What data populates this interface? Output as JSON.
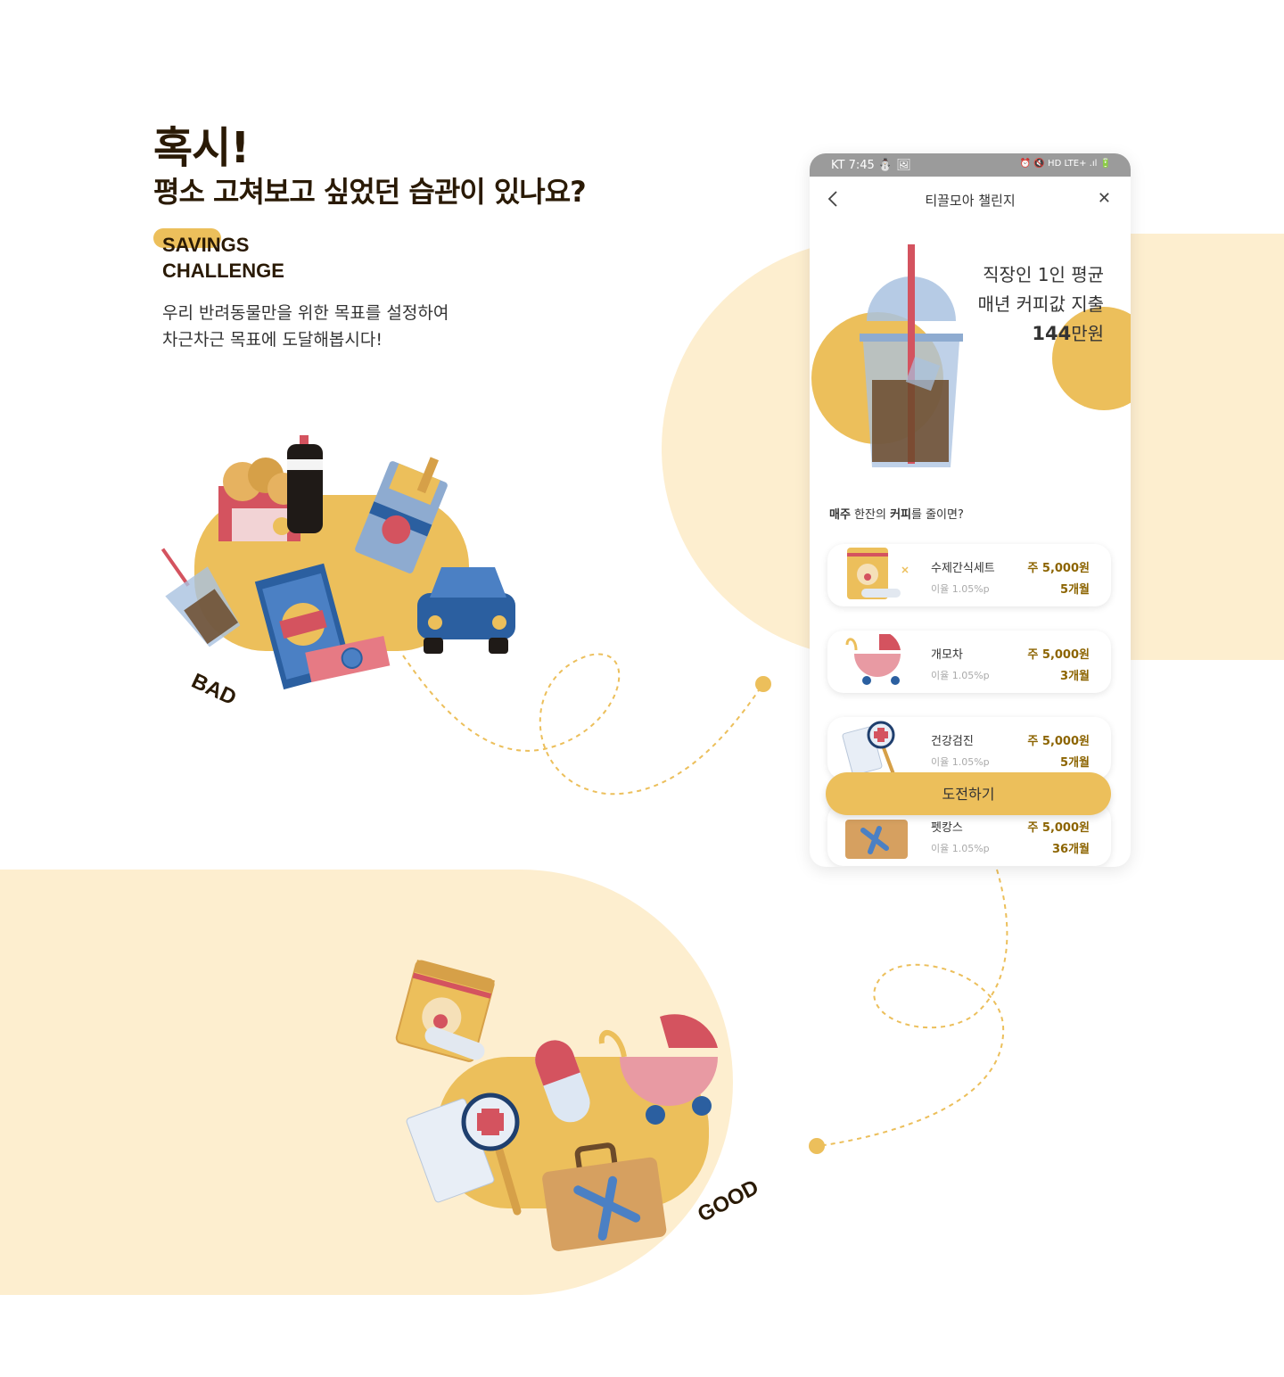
{
  "headline": {
    "line1": "혹시!",
    "line2": "평소 고쳐보고 싶었던 습관이 있나요?"
  },
  "tag": {
    "line1": "SAVINGS",
    "line2": "CHALLENGE"
  },
  "description": {
    "line1": "우리 반려동물만을 위한 목표를 설정하여",
    "line2": "차근차근 목표에 도달해봅시다!"
  },
  "labels": {
    "bad": "BAD",
    "good": "GOOD"
  },
  "phone": {
    "status": {
      "left": "KT 7:45 ⛄ 🖼",
      "right": "⏰ 🔇 HD LTE+ .ıl 🔋"
    },
    "nav": {
      "title": "티끌모아 챌린지"
    },
    "hero": {
      "line1": "직장인 1인 평균",
      "line2": "매년 커피값 지출",
      "amount": "144",
      "unit": "만원"
    },
    "question": {
      "part1": "매주",
      "part2": " 한잔의 ",
      "part3": "커피",
      "part4": "를 줄이면?"
    },
    "goals": [
      {
        "name": "수제간식세트",
        "rate": "이율 1.05%p",
        "price": "주 5,000원",
        "term": "5개월",
        "icon": "pet-snack-icon"
      },
      {
        "name": "개모차",
        "rate": "이율 1.05%p",
        "price": "주 5,000원",
        "term": "3개월",
        "icon": "pet-stroller-icon"
      },
      {
        "name": "건강검진",
        "rate": "이율 1.05%p",
        "price": "주 5,000원",
        "term": "5개월",
        "icon": "health-check-icon"
      },
      {
        "name": "펫캉스",
        "rate": "이율 1.05%p",
        "price": "주 5,000원",
        "term": "36개월",
        "icon": "travel-suitcase-icon"
      }
    ],
    "cta": "도전하기"
  },
  "colors": {
    "accent": "#ecbf5b",
    "background_soft": "#fdeecf",
    "text_dark": "#2a1a05",
    "price_text": "#8c6400",
    "blue": "#4b80c4",
    "red": "#d4535f"
  }
}
